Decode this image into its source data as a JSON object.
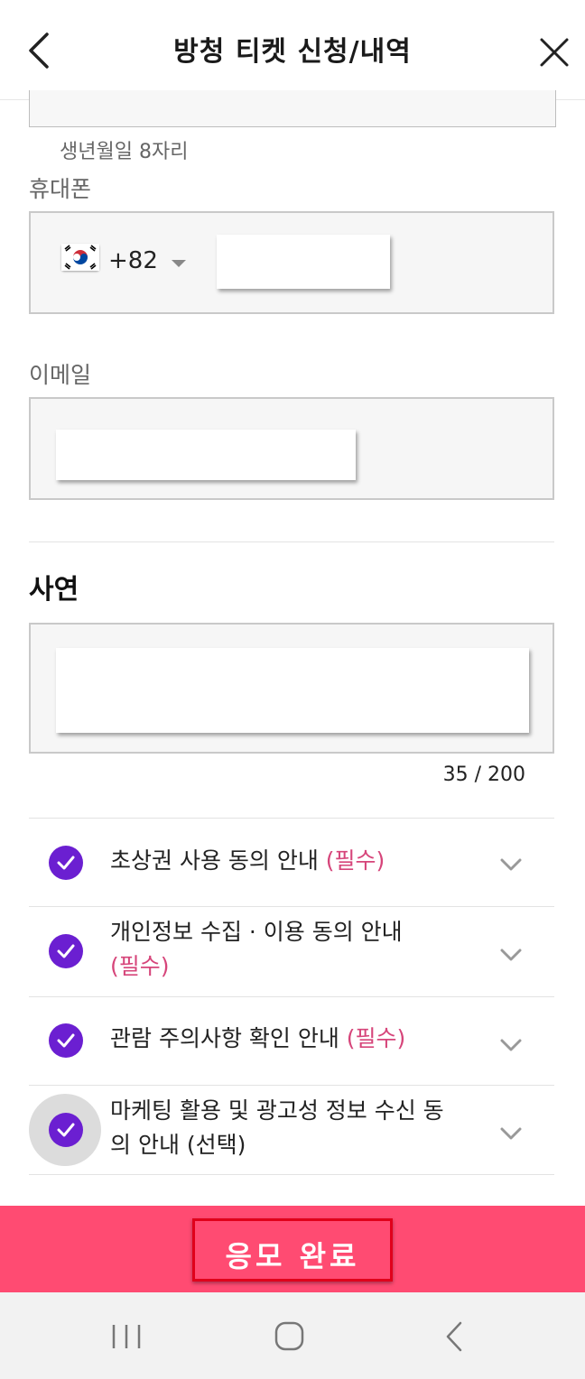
{
  "header": {
    "title": "방청 티켓 신청/내역"
  },
  "birth": {
    "hint": "생년월일 8자리"
  },
  "phone": {
    "label": "휴대폰",
    "country_code": "+82"
  },
  "email": {
    "label": "이메일"
  },
  "story": {
    "title": "사연",
    "counter": "35 / 200"
  },
  "agreements": [
    {
      "text": "초상권 사용 동의 안내 ",
      "tag": "(필수)"
    },
    {
      "text": "개인정보 수집 · 이용 동의 안내",
      "tag": "(필수)"
    },
    {
      "text": "관람 주의사항 확인 안내 ",
      "tag": "(필수)"
    },
    {
      "text": "마케팅 활용 및 광고성 정보 수신 동의 안내 (선택)",
      "tag": ""
    }
  ],
  "submit": {
    "label": "응모 완료"
  },
  "colors": {
    "accent": "#ff4b72",
    "check": "#6b1fd1",
    "required": "#d6457a"
  }
}
